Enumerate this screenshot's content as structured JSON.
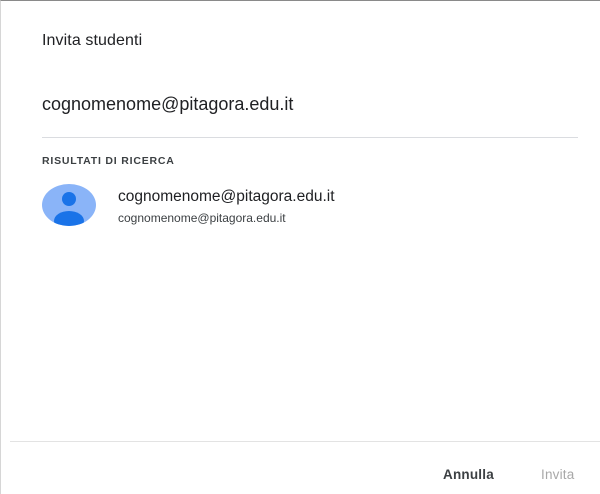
{
  "dialog": {
    "title": "Invita studenti"
  },
  "search": {
    "value": "cognomenome@pitagora.edu.it"
  },
  "results": {
    "section_label": "RISULTATI DI RICERCA",
    "items": [
      {
        "name": "cognomenome@pitagora.edu.it",
        "email": "cognomenome@pitagora.edu.it",
        "avatar_icon": "person-icon"
      }
    ]
  },
  "footer": {
    "cancel_label": "Annulla",
    "invite_label": "Invita"
  },
  "colors": {
    "avatar_bg": "#8ab4f8",
    "avatar_person": "#1a73e8",
    "disabled_text": "#a8a8a8"
  }
}
